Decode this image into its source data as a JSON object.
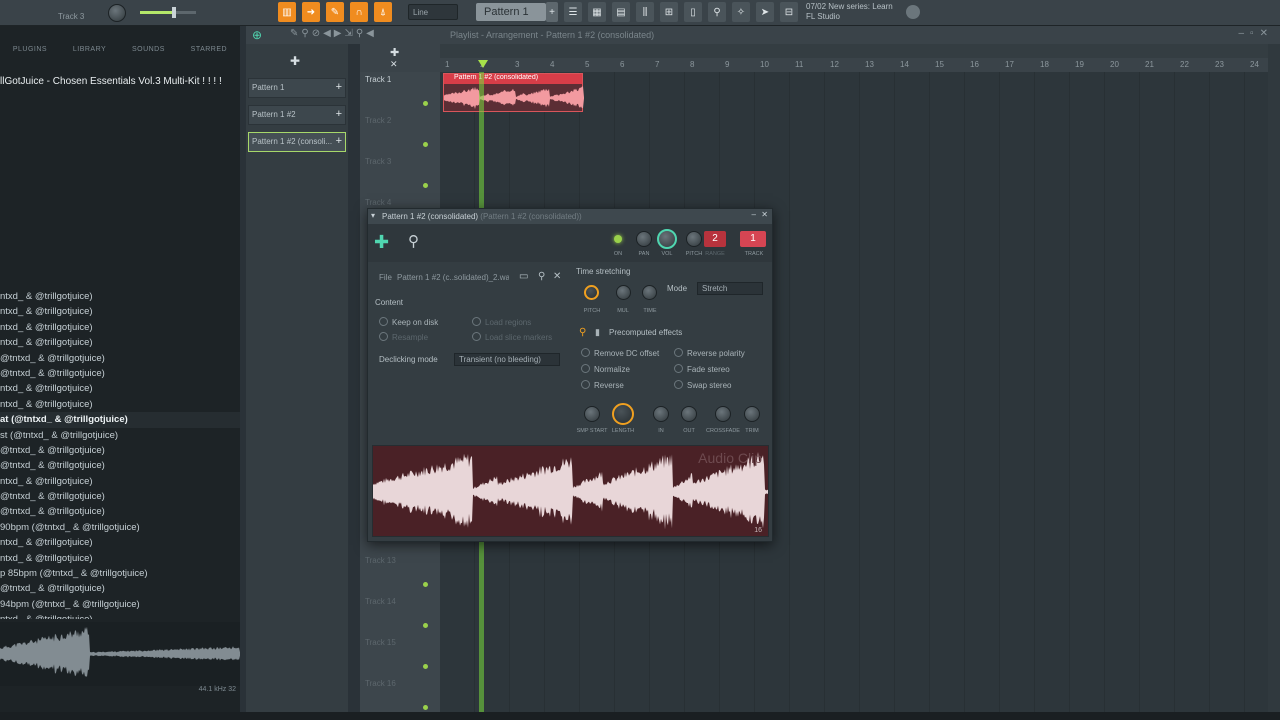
{
  "topbar": {
    "channel_name": "Track 3",
    "snap_mode": "Line",
    "pattern_label": "Pattern 1",
    "hint_line1": "07/02  New series: Learn",
    "hint_line2": "FL Studio"
  },
  "browser": {
    "tabs": [
      "PLUGINS",
      "LIBRARY",
      "SOUNDS",
      "STARRED"
    ],
    "folder_title": "llGotJuice - Chosen Essentials Vol.3 Multi-Kit ! ! ! !",
    "items": [
      "ntxd_ & @trillgotjuice)",
      "ntxd_ & @trillgotjuice)",
      "ntxd_ & @trillgotjuice)",
      "ntxd_ & @trillgotjuice)",
      "@tntxd_ & @trillgotjuice)",
      "@tntxd_ & @trillgotjuice)",
      "ntxd_ & @trillgotjuice)",
      "ntxd_ & @trillgotjuice)",
      "at (@tntxd_ & @trillgotjuice)",
      "st (@tntxd_ & @trillgotjuice)",
      "@tntxd_ & @trillgotjuice)",
      "@tntxd_ & @trillgotjuice)",
      "ntxd_ & @trillgotjuice)",
      "@tntxd_ & @trillgotjuice)",
      "@tntxd_ & @trillgotjuice)",
      "90bpm (@tntxd_ & @trillgotjuice)",
      "ntxd_ & @trillgotjuice)",
      "ntxd_ & @trillgotjuice)",
      "p 85bpm (@tntxd_ & @trillgotjuice)",
      "@tntxd_ & @trillgotjuice)",
      "94bpm (@tntxd_ & @trillgotjuice)",
      "ntxd_ & @trillgotjuice)"
    ],
    "selected_index": 8,
    "preview_info": "44.1 kHz 32"
  },
  "picker": {
    "items": [
      "Pattern 1",
      "Pattern 1 #2",
      "Pattern 1 #2 (consoli..."
    ],
    "selected_index": 2
  },
  "playlist": {
    "title": "Playlist - Arrangement - Pattern 1 #2 (consolidated)",
    "bars": [
      "1",
      "2",
      "3",
      "4",
      "5",
      "6",
      "7",
      "8",
      "9",
      "10",
      "11",
      "12",
      "13",
      "14",
      "15",
      "16",
      "17",
      "18",
      "19",
      "20",
      "21",
      "22",
      "23",
      "24"
    ],
    "tracks": [
      "Track 1",
      "Track 2",
      "Track 3",
      "Track 4",
      "Track 13",
      "Track 14",
      "Track 15",
      "Track 16"
    ],
    "clip_name": "Pattern 1 #2 (consolidated)"
  },
  "channel_window": {
    "title": "Pattern 1 #2 (consolidated)",
    "title_sub": "(Pattern 1 #2 (consolidated))",
    "knob_labels": [
      "ON",
      "PAN",
      "VOL",
      "PITCH",
      "RANGE",
      "TRACK"
    ],
    "range_value": "2",
    "track_value": "1",
    "file_label": "File",
    "file_value": "Pattern 1 #2 (c..solidated)_2.wav",
    "content_label": "Content",
    "keep_on_disk": "Keep on disk",
    "resample": "Resample",
    "load_regions": "Load regions",
    "load_slice_markers": "Load slice markers",
    "declicking_label": "Declicking mode",
    "declicking_value": "Transient (no bleeding)",
    "time_stretching": "Time stretching",
    "ts_knobs": [
      "PITCH",
      "MUL",
      "TIME"
    ],
    "mode_label": "Mode",
    "mode_value": "Stretch",
    "precomputed_effects": "Precomputed effects",
    "effects_left": [
      "Remove DC offset",
      "Normalize",
      "Reverse"
    ],
    "effects_right": [
      "Reverse polarity",
      "Fade stereo",
      "Swap stereo"
    ],
    "fx_knobs": [
      "SMP START",
      "LENGTH",
      "IN",
      "OUT",
      "CROSSFADE",
      "TRIM"
    ],
    "wave_watermark": "Audio Clip",
    "wave_info": "16"
  }
}
